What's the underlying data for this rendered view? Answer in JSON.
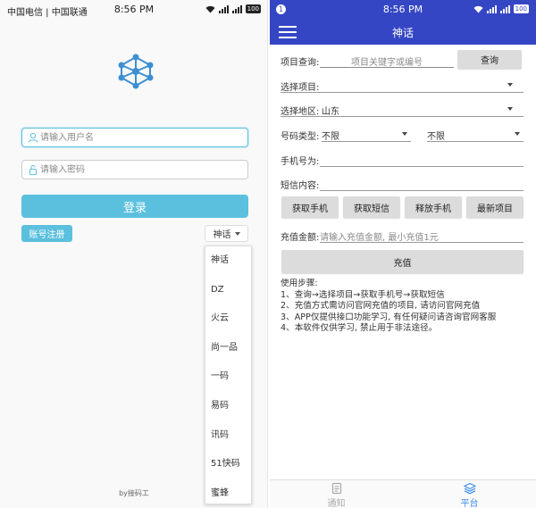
{
  "login_screen": {
    "status_bar": {
      "carrier": "中国电信 | 中国联通",
      "time": "8:56 PM",
      "battery": "100"
    },
    "logo_icon": "network-molecule-icon",
    "username_placeholder": "请输入用户名",
    "password_placeholder": "请输入密码",
    "login_button": "登录",
    "register_button": "账号注册",
    "source_select": {
      "selected": "神话",
      "options": [
        "神话",
        "DZ",
        "火云",
        "尚一品",
        "一码",
        "易码",
        "讯码",
        "51快码",
        "蜜蜂"
      ]
    },
    "footer": "by接码工",
    "colors": {
      "accent": "#5bc0de"
    }
  },
  "platform_screen": {
    "status_bar": {
      "time": "8:56 PM",
      "battery": "100",
      "notification_dot": "1"
    },
    "title": "神话",
    "project_query": {
      "label": "项目查询:",
      "placeholder": "项目关键字或编号",
      "button": "查询"
    },
    "select_project": {
      "label": "选择项目:",
      "value": ""
    },
    "select_region": {
      "label": "选择地区:",
      "value": "山东"
    },
    "number_type": {
      "label": "号码类型:",
      "value1": "不限",
      "value2": "不限"
    },
    "phone_number": {
      "label": "手机号为:",
      "value": ""
    },
    "sms_content": {
      "label": "短信内容:",
      "value": ""
    },
    "action_buttons": [
      "获取手机",
      "获取短信",
      "释放手机",
      "最新项目"
    ],
    "recharge": {
      "label": "充值金额:",
      "placeholder": "请输入充值金额, 最小充值1元",
      "button": "充值"
    },
    "instructions": {
      "heading": "使用步骤:",
      "lines": [
        "1、查询→选择项目→获取手机号→获取短信",
        "2、充值方式需访问官网充值的项目, 请访问官网充值",
        "3、APP仅提供接口功能学习, 有任何疑问请咨询官网客服",
        "4、本软件仅供学习, 禁止用于非法途径。"
      ]
    },
    "bottom_nav": [
      {
        "label": "通知",
        "icon": "notice-icon",
        "active": false
      },
      {
        "label": "平台",
        "icon": "layers-icon",
        "active": true
      }
    ],
    "colors": {
      "primary": "#3546c4",
      "active_tab": "#3f8ee6"
    }
  }
}
